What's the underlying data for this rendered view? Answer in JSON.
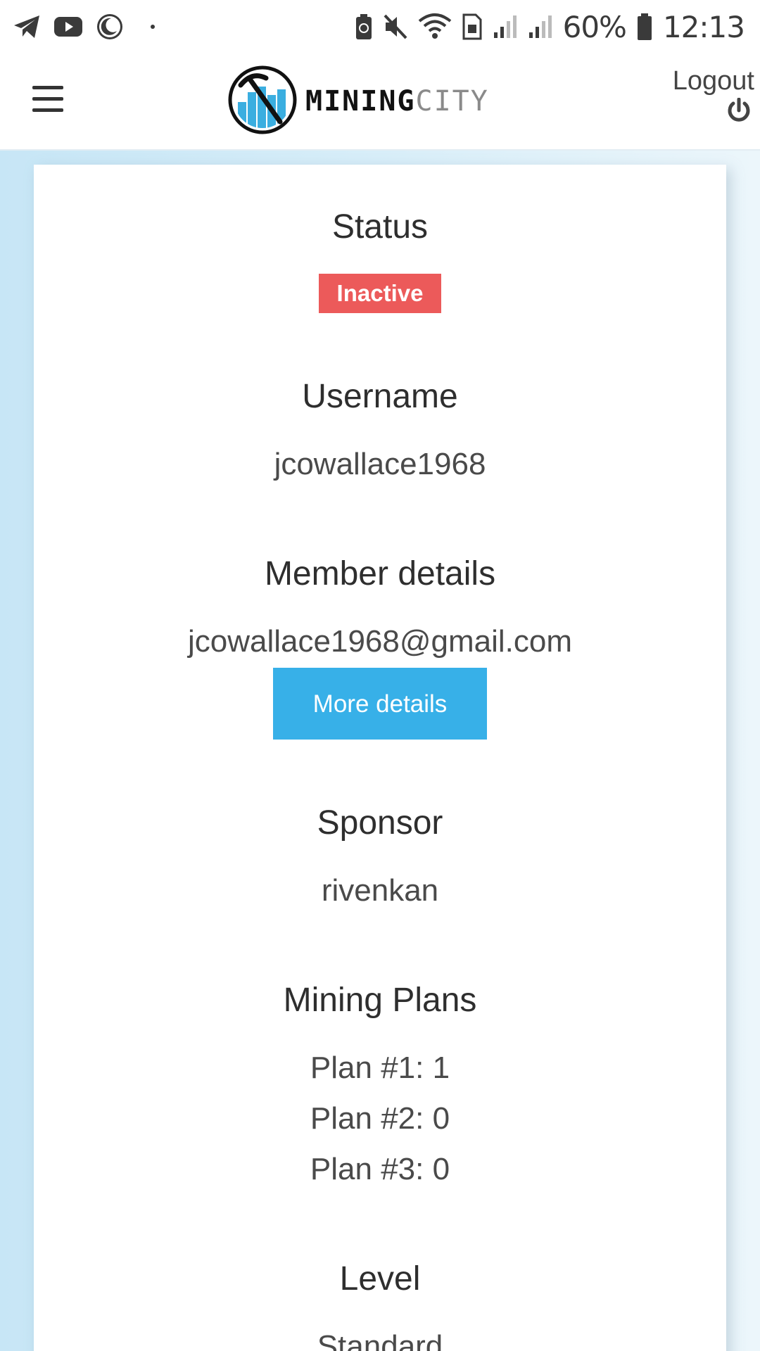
{
  "status_bar": {
    "battery_percent": "60%",
    "time": "12:13",
    "left_icons": [
      "telegram-icon",
      "youtube-icon",
      "moon-icon"
    ],
    "right_icons": [
      "battery-saver-icon",
      "mute-icon",
      "wifi-icon",
      "sim-icon",
      "signal-icon",
      "signal-icon",
      "battery-icon"
    ]
  },
  "header": {
    "logo_mining": "MINING",
    "logo_city": "CITY",
    "logout_label": "Logout"
  },
  "profile": {
    "status_title": "Status",
    "status_badge": "Inactive",
    "username_title": "Username",
    "username": "jcowallace1968",
    "member_title": "Member details",
    "email": "jcowallace1968@gmail.com",
    "more_details_button": "More details",
    "sponsor_title": "Sponsor",
    "sponsor": "rivenkan",
    "plans_title": "Mining Plans",
    "plans": [
      "Plan #1: 1",
      "Plan #2: 0",
      "Plan #3: 0"
    ],
    "level_title": "Level",
    "level": "Standard"
  },
  "colors": {
    "inactive_badge": "#ec5a5a",
    "primary_button": "#37b0e8",
    "page_background": "#d8eef9"
  }
}
